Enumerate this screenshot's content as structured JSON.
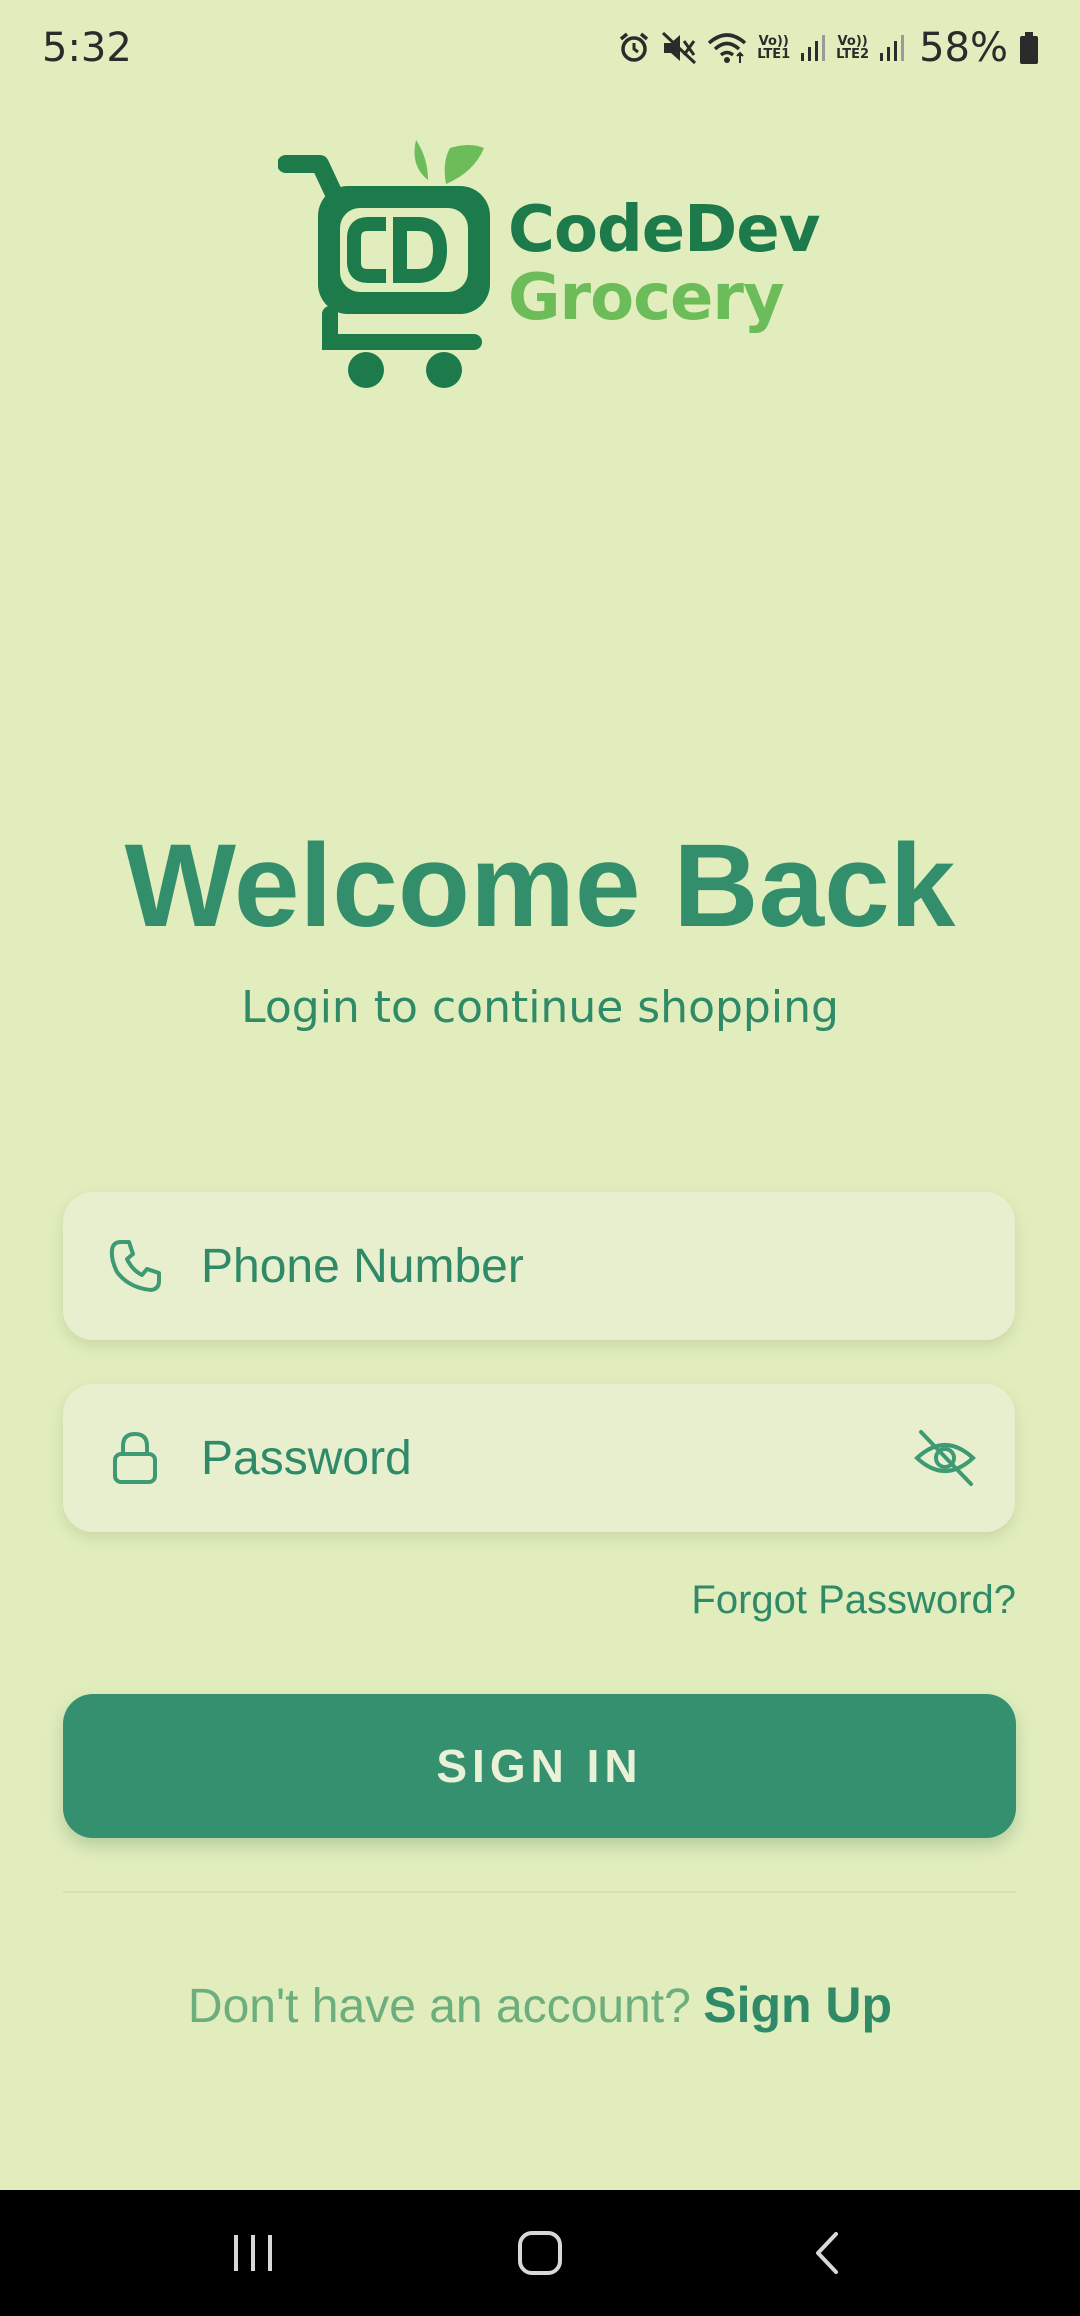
{
  "status_bar": {
    "time": "5:32",
    "sim1_label_top": "Vo))",
    "sim1_label_bottom": "LTE1",
    "sim2_label_top": "Vo))",
    "sim2_label_bottom": "LTE2",
    "battery": "58%",
    "icons": [
      "alarm-icon",
      "mute-icon",
      "wifi-icon",
      "signal-icon",
      "signal-icon",
      "battery-icon"
    ]
  },
  "logo": {
    "line1": "CodeDev",
    "line2": "Grocery",
    "monogram": "CD"
  },
  "heading": {
    "title": "Welcome Back",
    "subtitle": "Login to continue shopping"
  },
  "form": {
    "phone_placeholder": "Phone Number",
    "password_placeholder": "Password",
    "forgot_label": "Forgot Password?",
    "signin_label": "SIGN IN"
  },
  "footer": {
    "prompt": "Don't have an account?",
    "signup_label": "Sign Up"
  },
  "colors": {
    "background": "#e1edbd",
    "primary": "#35906f",
    "accent_text": "#2f8a68",
    "logo_dark": "#1c7a4b",
    "logo_light": "#6cbc5a"
  },
  "nav": {
    "icons": [
      "recents-icon",
      "home-icon",
      "back-icon"
    ]
  }
}
